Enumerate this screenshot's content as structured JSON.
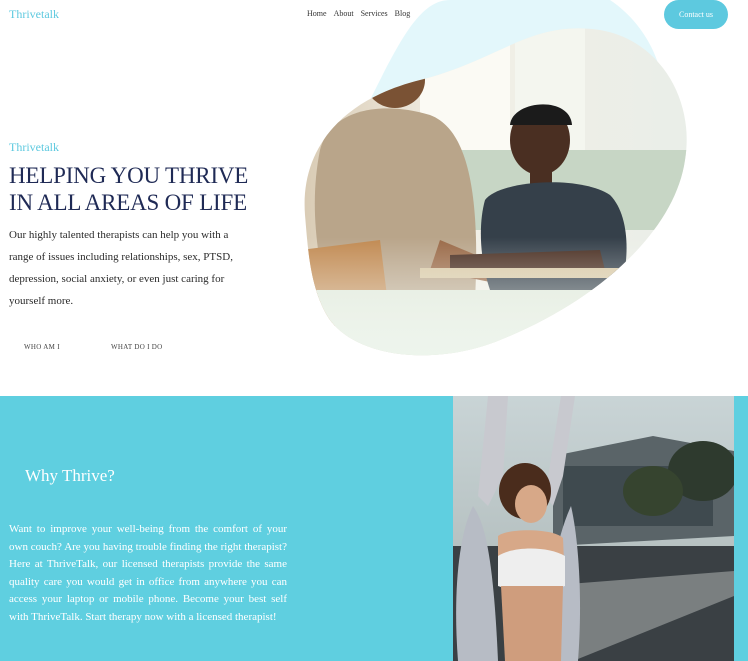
{
  "header": {
    "logo": "Thrivetalk",
    "nav": [
      "Home",
      "About",
      "Services",
      "Blog"
    ],
    "contact_label": "Contact us"
  },
  "hero": {
    "brand": "Thrivetalk",
    "title_line1": "HELPING YOU THRIVE",
    "title_line2": "IN ALL AREAS OF LIFE",
    "description": "Our highly talented therapists can help you with a range of issues including relationships, sex, PTSD, depression, social anxiety, or even just caring for yourself more.",
    "link_who": "WHO AM I",
    "link_what": "WHAT DO I DO"
  },
  "why": {
    "title": "Why Thrive?",
    "text": "Want to improve your well-being from the comfort of your own couch? Are you having trouble finding the right therapist? Here at ThriveTalk, our licensed therapists provide the same quality care you would get in office from anywhere you can access your laptop or mobile phone. Become your best self with ThriveTalk. Start therapy now with a licensed therapist!"
  },
  "colors": {
    "accent": "#5dc9df",
    "section_bg": "#5fcfe0",
    "title": "#1f2a55"
  }
}
